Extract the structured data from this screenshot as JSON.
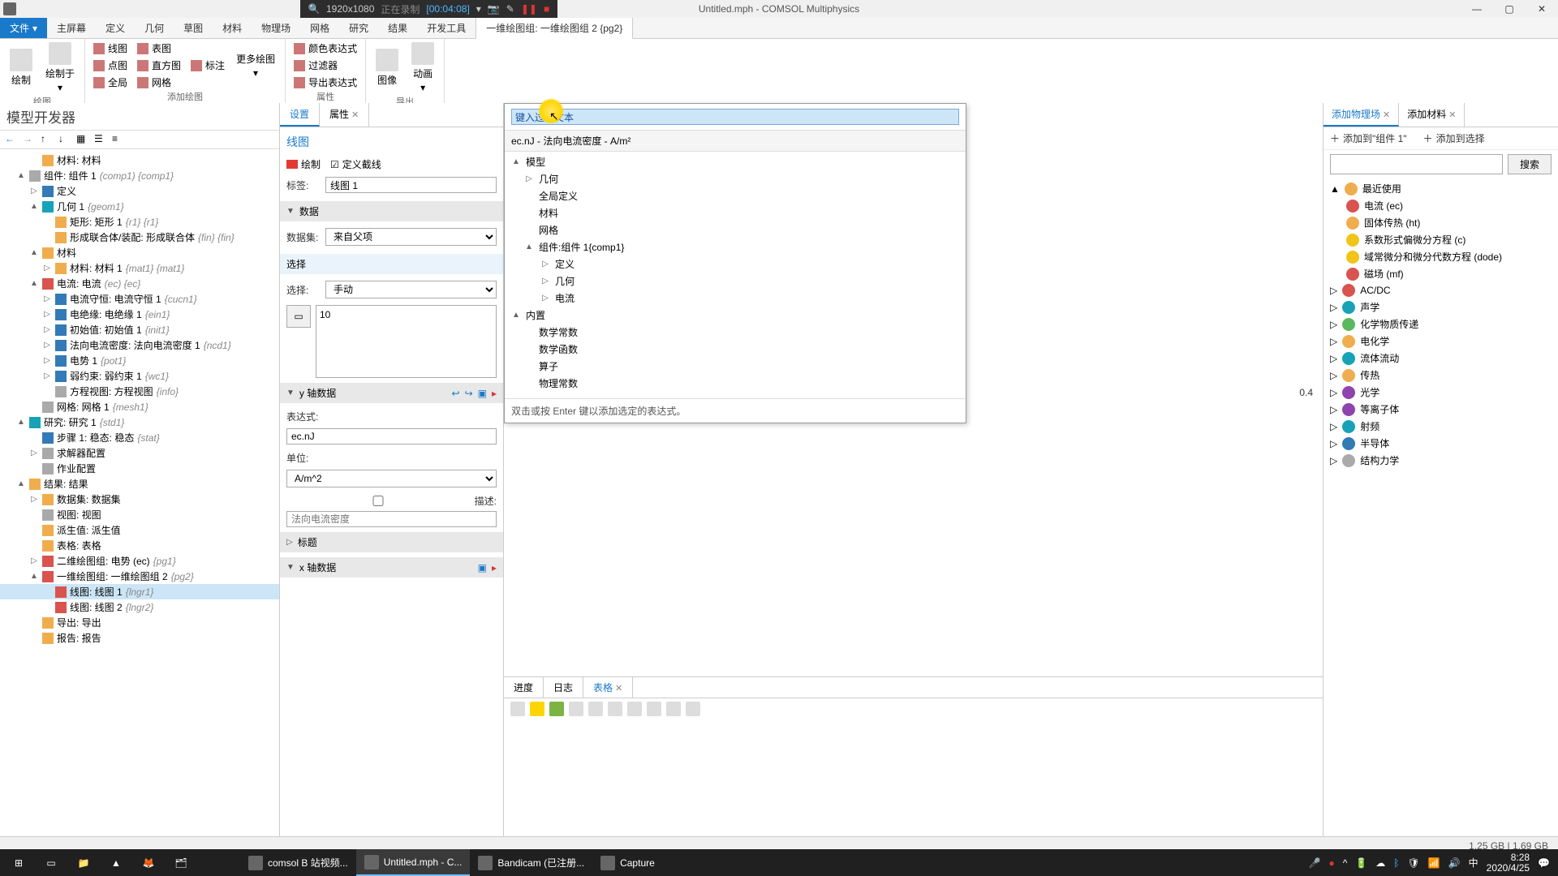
{
  "titlebar": {
    "title": "Untitled.mph - COMSOL Multiphysics"
  },
  "recbar": {
    "res": "1920x1080",
    "status": "正在录制",
    "time": "[00:04:08]"
  },
  "ribbon": {
    "file": "文件",
    "tabs": [
      "主屏幕",
      "定义",
      "几何",
      "草图",
      "材料",
      "物理场",
      "网格",
      "研究",
      "结果",
      "开发工具"
    ],
    "activeTab": "一维绘图组: 一维绘图组 2 {pg2}",
    "groups": {
      "g1": {
        "label": "绘图",
        "btn1": "绘制",
        "btn2": "绘制于"
      },
      "g2": {
        "label": "添加绘图",
        "items": [
          "线图",
          "表图",
          "标注",
          "点图",
          "直方图",
          "全局",
          "网格"
        ],
        "more": "更多绘图"
      },
      "g3": {
        "label": "属性",
        "items": [
          "颜色表达式",
          "过滤器",
          "导出表达式"
        ]
      },
      "g4": {
        "label": "导出",
        "btn1": "图像",
        "btn2": "动画"
      }
    }
  },
  "modelBuilder": {
    "title": "模型开发器",
    "tree": [
      {
        "lvl": 2,
        "exp": "",
        "label": "材料: 材料",
        "ic": "ic-orange"
      },
      {
        "lvl": 1,
        "exp": "▲",
        "label": "组件: 组件 1",
        "em": "(comp1) {comp1}",
        "ic": "ic-gray"
      },
      {
        "lvl": 2,
        "exp": "▷",
        "label": "定义",
        "ic": "ic-blue"
      },
      {
        "lvl": 2,
        "exp": "▲",
        "label": "几何 1",
        "em": "{geom1}",
        "ic": "ic-teal"
      },
      {
        "lvl": 3,
        "exp": "",
        "label": "矩形: 矩形 1",
        "em": "{r1} {r1}",
        "ic": "ic-orange"
      },
      {
        "lvl": 3,
        "exp": "",
        "label": "形成联合体/装配: 形成联合体",
        "em": "{fin} {fin}",
        "ic": "ic-orange"
      },
      {
        "lvl": 2,
        "exp": "▲",
        "label": "材料",
        "ic": "ic-orange"
      },
      {
        "lvl": 3,
        "exp": "▷",
        "label": "材料: 材料 1",
        "em": "{mat1} {mat1}",
        "ic": "ic-orange"
      },
      {
        "lvl": 2,
        "exp": "▲",
        "label": "电流: 电流",
        "em": "(ec) {ec}",
        "ic": "ic-red"
      },
      {
        "lvl": 3,
        "exp": "▷",
        "label": "电流守恒: 电流守恒 1",
        "em": "{cucn1}",
        "ic": "ic-blue"
      },
      {
        "lvl": 3,
        "exp": "▷",
        "label": "电绝缘: 电绝缘 1",
        "em": "{ein1}",
        "ic": "ic-blue"
      },
      {
        "lvl": 3,
        "exp": "▷",
        "label": "初始值: 初始值 1",
        "em": "{init1}",
        "ic": "ic-blue"
      },
      {
        "lvl": 3,
        "exp": "▷",
        "label": "法向电流密度: 法向电流密度 1",
        "em": "{ncd1}",
        "ic": "ic-blue"
      },
      {
        "lvl": 3,
        "exp": "▷",
        "label": "电势 1",
        "em": "{pot1}",
        "ic": "ic-blue"
      },
      {
        "lvl": 3,
        "exp": "▷",
        "label": "弱约束: 弱约束 1",
        "em": "{wc1}",
        "ic": "ic-blue"
      },
      {
        "lvl": 3,
        "exp": "",
        "label": "方程视图: 方程视图",
        "em": "{info}",
        "ic": "ic-gray"
      },
      {
        "lvl": 2,
        "exp": "",
        "label": "网格: 网格 1",
        "em": "{mesh1}",
        "ic": "ic-gray"
      },
      {
        "lvl": 1,
        "exp": "▲",
        "label": "研究: 研究 1",
        "em": "{std1}",
        "ic": "ic-teal"
      },
      {
        "lvl": 2,
        "exp": "",
        "label": "步骤 1: 稳态: 稳态",
        "em": "{stat}",
        "ic": "ic-blue"
      },
      {
        "lvl": 2,
        "exp": "▷",
        "label": "求解器配置",
        "ic": "ic-gray"
      },
      {
        "lvl": 2,
        "exp": "",
        "label": "作业配置",
        "ic": "ic-gray"
      },
      {
        "lvl": 1,
        "exp": "▲",
        "label": "结果: 结果",
        "ic": "ic-orange"
      },
      {
        "lvl": 2,
        "exp": "▷",
        "label": "数据集: 数据集",
        "ic": "ic-orange"
      },
      {
        "lvl": 2,
        "exp": "",
        "label": "视图: 视图",
        "ic": "ic-gray"
      },
      {
        "lvl": 2,
        "exp": "",
        "label": "派生值: 派生值",
        "ic": "ic-orange"
      },
      {
        "lvl": 2,
        "exp": "",
        "label": "表格: 表格",
        "ic": "ic-orange"
      },
      {
        "lvl": 2,
        "exp": "▷",
        "label": "二维绘图组: 电势 (ec)",
        "em": "{pg1}",
        "ic": "ic-red"
      },
      {
        "lvl": 2,
        "exp": "▲",
        "label": "一维绘图组: 一维绘图组 2",
        "em": "{pg2}",
        "ic": "ic-red"
      },
      {
        "lvl": 3,
        "exp": "",
        "label": "线图: 线图 1",
        "em": "{lngr1}",
        "ic": "ic-red",
        "sel": true
      },
      {
        "lvl": 3,
        "exp": "",
        "label": "线图: 线图 2",
        "em": "{lngr2}",
        "ic": "ic-red"
      },
      {
        "lvl": 2,
        "exp": "",
        "label": "导出: 导出",
        "ic": "ic-orange"
      },
      {
        "lvl": 2,
        "exp": "",
        "label": "报告: 报告",
        "ic": "ic-orange"
      }
    ]
  },
  "settings": {
    "tab1": "设置",
    "tab2": "属性",
    "subtitle": "线图",
    "plotBtn": "绘制",
    "cutlineBtn": "定义截线",
    "labelLbl": "标签:",
    "labelVal": "线图 1",
    "sec_data": "数据",
    "dsLbl": "数据集:",
    "dsVal": "来自父项",
    "sec_select": "选择",
    "selLbl": "选择:",
    "selVal": "手动",
    "selItem": "10",
    "sec_ydata": "y 轴数据",
    "exprLbl": "表达式:",
    "exprVal": "ec.nJ",
    "unitLbl": "单位:",
    "unitVal": "A/m^2",
    "descLbl": "描述:",
    "descPlaceholder": "法向电流密度",
    "sec_title": "标题",
    "sec_xdata": "x 轴数据"
  },
  "popup": {
    "filterPlaceholder": "键入过滤文本",
    "row": "ec.nJ - 法向电流密度 - A/m²",
    "tree": [
      {
        "lvl": 0,
        "exp": "▲",
        "label": "模型"
      },
      {
        "lvl": 1,
        "exp": "▷",
        "label": "几何"
      },
      {
        "lvl": 1,
        "exp": "",
        "label": "全局定义"
      },
      {
        "lvl": 1,
        "exp": "",
        "label": "材料"
      },
      {
        "lvl": 1,
        "exp": "",
        "label": "网格"
      },
      {
        "lvl": 1,
        "exp": "▲",
        "label": "组件:组件 1{comp1}"
      },
      {
        "lvl": 2,
        "exp": "▷",
        "label": "定义"
      },
      {
        "lvl": 2,
        "exp": "▷",
        "label": "几何"
      },
      {
        "lvl": 2,
        "exp": "▷",
        "label": "电流"
      },
      {
        "lvl": 0,
        "exp": "▲",
        "label": "内置"
      },
      {
        "lvl": 1,
        "exp": "",
        "label": "数学常数"
      },
      {
        "lvl": 1,
        "exp": "",
        "label": "数学函数"
      },
      {
        "lvl": 1,
        "exp": "",
        "label": "算子"
      },
      {
        "lvl": 1,
        "exp": "",
        "label": "物理常数"
      }
    ],
    "footer": "双击或按 Enter 键以添加选定的表达式。"
  },
  "axisVal": "0.4",
  "bottomTabs": {
    "t1": "进度",
    "t2": "日志",
    "t3": "表格"
  },
  "rightPanel": {
    "tab1": "添加物理场",
    "tab2": "添加材料",
    "add1": "添加到\"组件 1\"",
    "add2": "添加到选择",
    "searchBtn": "搜索",
    "recent": "最近使用",
    "recentItems": [
      {
        "label": "电流 (ec)",
        "ic": "ic-red"
      },
      {
        "label": "固体传热 (ht)",
        "ic": "ic-orange"
      },
      {
        "label": "系数形式偏微分方程 (c)",
        "ic": "ic-yellow"
      },
      {
        "label": "域常微分和微分代数方程 (dode)",
        "ic": "ic-yellow"
      },
      {
        "label": "磁场 (mf)",
        "ic": "ic-red"
      }
    ],
    "categories": [
      {
        "label": "AC/DC",
        "ic": "ic-red"
      },
      {
        "label": "声学",
        "ic": "ic-teal"
      },
      {
        "label": "化学物质传递",
        "ic": "ic-green"
      },
      {
        "label": "电化学",
        "ic": "ic-orange"
      },
      {
        "label": "流体流动",
        "ic": "ic-teal"
      },
      {
        "label": "传热",
        "ic": "ic-orange"
      },
      {
        "label": "光学",
        "ic": "ic-purple"
      },
      {
        "label": "等离子体",
        "ic": "ic-purple"
      },
      {
        "label": "射频",
        "ic": "ic-teal"
      },
      {
        "label": "半导体",
        "ic": "ic-blue"
      },
      {
        "label": "结构力学",
        "ic": "ic-gray"
      }
    ]
  },
  "statusbar": {
    "mem": "1.25 GB | 1.69 GB"
  },
  "taskbar": {
    "apps": [
      {
        "label": "comsol B 站视频...",
        "ic": "ic-orange"
      },
      {
        "label": "Untitled.mph - C...",
        "ic": "ic-blue"
      },
      {
        "label": "Bandicam (已注册...",
        "ic": "ic-red"
      },
      {
        "label": "Capture",
        "ic": "ic-yellow"
      }
    ],
    "ime": "中",
    "time": "8:28",
    "date": "2020/4/25"
  }
}
